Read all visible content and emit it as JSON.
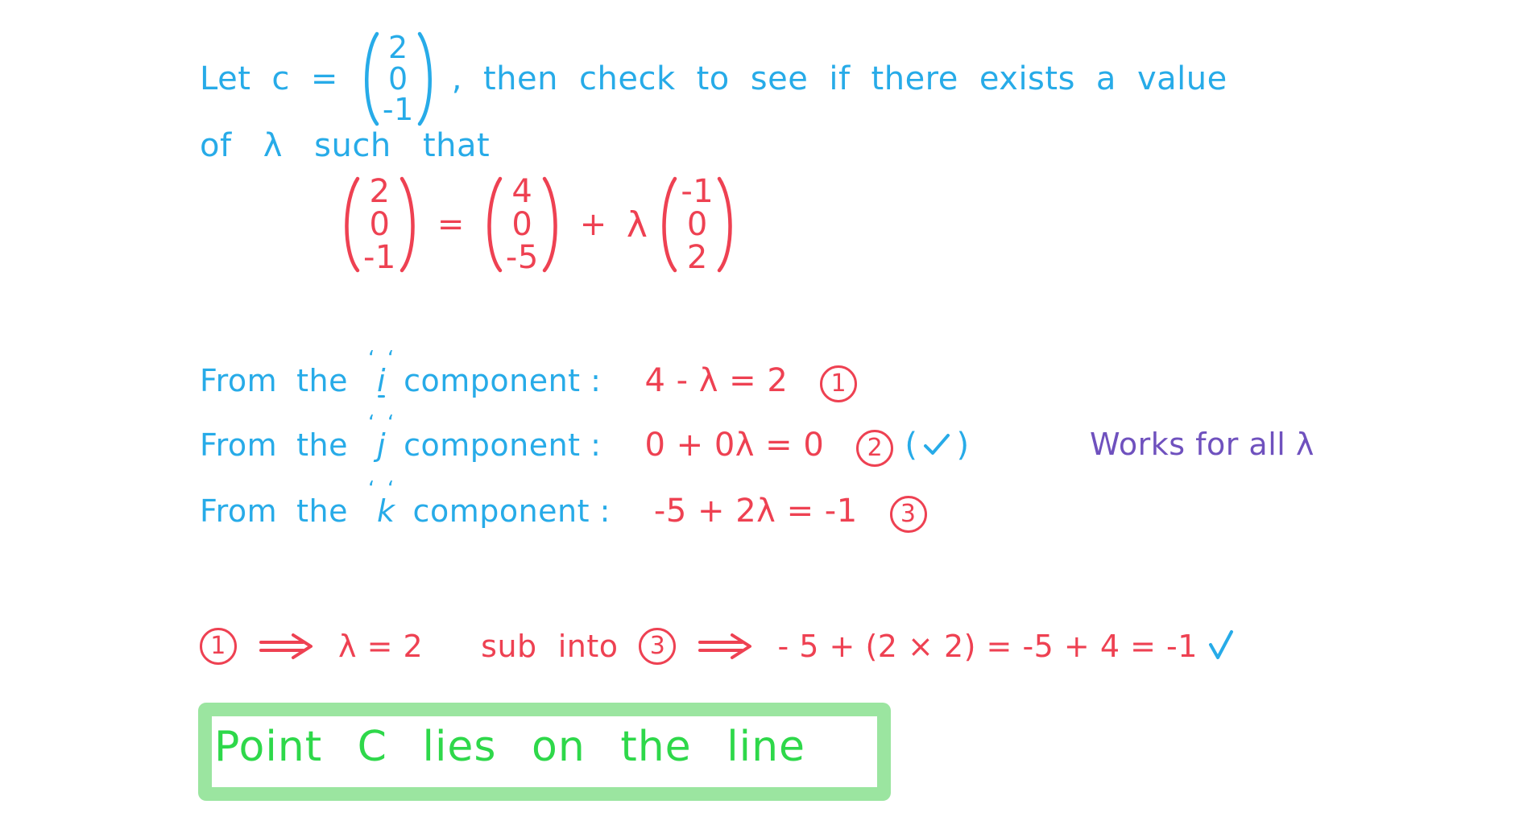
{
  "colors": {
    "blue": "#27ABE8",
    "red": "#EE4152",
    "purple": "#6F51BE",
    "green_text": "#2ED84A",
    "green_box": "#9BE5A0",
    "background": "#FFFFFF"
  },
  "prose": {
    "line1": {
      "before_vector": [
        "Let",
        "c",
        "="
      ],
      "vector": [
        "2",
        "0",
        "-1"
      ],
      "after_vector": [
        ",",
        "then",
        "check",
        "to",
        "see",
        "if",
        "there",
        "exists",
        "a",
        "value"
      ]
    },
    "line2": [
      "of",
      "λ",
      "such",
      "that"
    ]
  },
  "equation": {
    "lhs": [
      "2",
      "0",
      "-1"
    ],
    "equals": "=",
    "rhs_point": [
      "4",
      "0",
      "-5"
    ],
    "plus": "+",
    "lambda": "λ",
    "rhs_direction": [
      "-1",
      "0",
      "2"
    ]
  },
  "components": [
    {
      "label_before": [
        "From",
        "the"
      ],
      "unit": "i",
      "quote_left": "‘",
      "quote_right": "‘",
      "label_after": "component :",
      "equation": "4 - λ  = 2",
      "ref": "1",
      "tick": false,
      "note": null
    },
    {
      "label_before": [
        "From",
        "the"
      ],
      "unit": "j",
      "quote_left": "‘",
      "quote_right": "‘",
      "label_after": "component :",
      "equation": "0 + 0λ = 0",
      "ref": "2",
      "tick": true,
      "tick_open": "(",
      "tick_close": ")",
      "note": "Works for all λ"
    },
    {
      "label_before": [
        "From",
        "the"
      ],
      "unit": "k",
      "quote_left": "‘",
      "quote_right": "‘",
      "label_after": "component :",
      "equation": "-5 + 2λ = -1",
      "ref": "3",
      "tick": false,
      "note": null
    }
  ],
  "deduction": {
    "ref_from": "1",
    "arrow": "⟹",
    "result": "λ = 2",
    "sub_text_1": "sub",
    "sub_text_2": "into",
    "ref_into": "3",
    "arrow_2": "⟹",
    "check_work": "- 5 + (2 × 2) = -5 + 4 = -1",
    "final_tick": "✓"
  },
  "answer": {
    "words": [
      "Point",
      "C",
      "lies",
      "on",
      "the",
      "line"
    ]
  },
  "chart_data": {
    "type": "table",
    "title": "Vector line membership check",
    "rows": [
      {
        "component": "i",
        "equation": "4 - λ = 2",
        "ref": "1"
      },
      {
        "component": "j",
        "equation": "0 + 0λ = 0",
        "ref": "2"
      },
      {
        "component": "k",
        "equation": "-5 + 2λ = -1",
        "ref": "3"
      }
    ],
    "solution_lambda": 2,
    "conclusion": "Point C lies on the line"
  }
}
